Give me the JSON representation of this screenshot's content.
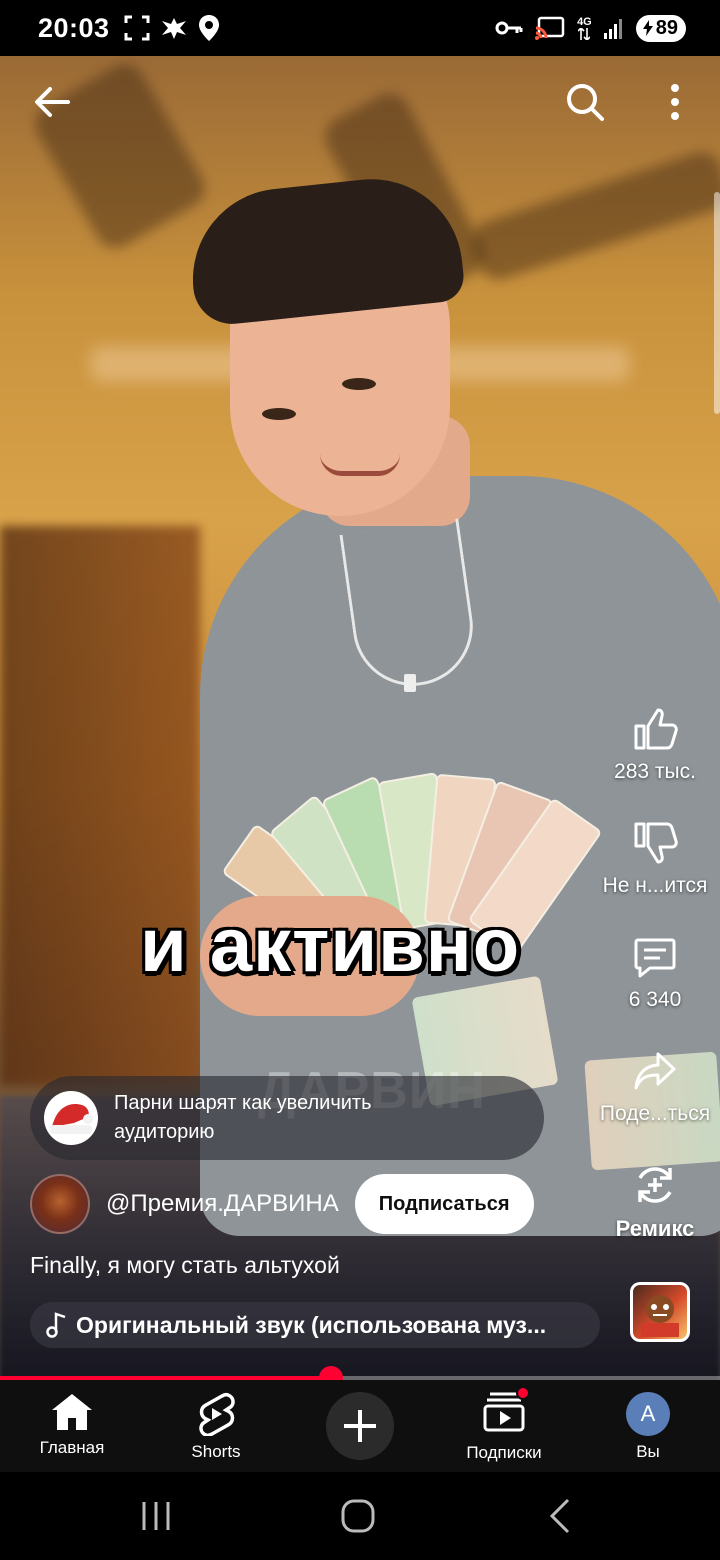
{
  "status_bar": {
    "time": "20:03",
    "battery": "89",
    "network": "4G",
    "icons": [
      "screenshot-frame-icon",
      "emblem-icon",
      "location-pin-icon",
      "vpn-key-icon",
      "cast-icon",
      "signal-icon",
      "battery-icon"
    ]
  },
  "video": {
    "caption": "и активно",
    "watermark": "ДАРВИН"
  },
  "top_bar": {
    "icons": [
      "back-arrow-icon",
      "search-icon",
      "more-vert-icon"
    ]
  },
  "actions": {
    "like_count": "283 тыс.",
    "dislike_label": "Не н...ится",
    "comment_count": "6 340",
    "share_label": "Поде...ться",
    "remix_label": "Ремикс"
  },
  "suggestion": {
    "text": "Парни шарят как увеличить аудиторию"
  },
  "channel": {
    "name": "@Премия.ДАРВИНА",
    "subscribe_label": "Подписаться"
  },
  "description": "Finally, я могу стать альтухой",
  "sound": {
    "label": "Оригинальный звук (использована муз..."
  },
  "progress": {
    "fraction": 0.46,
    "color": "#ff0033"
  },
  "bottom_nav": {
    "items": [
      {
        "label": "Главная",
        "icon": "home-icon"
      },
      {
        "label": "Shorts",
        "icon": "shorts-icon"
      },
      {
        "label": "",
        "icon": "plus-icon"
      },
      {
        "label": "Подписки",
        "icon": "subscriptions-icon"
      },
      {
        "label": "Вы",
        "icon": "avatar"
      }
    ],
    "avatar_letter": "A"
  },
  "colors": {
    "accent": "#ff0033",
    "nav_bg": "#0f0f0f"
  }
}
